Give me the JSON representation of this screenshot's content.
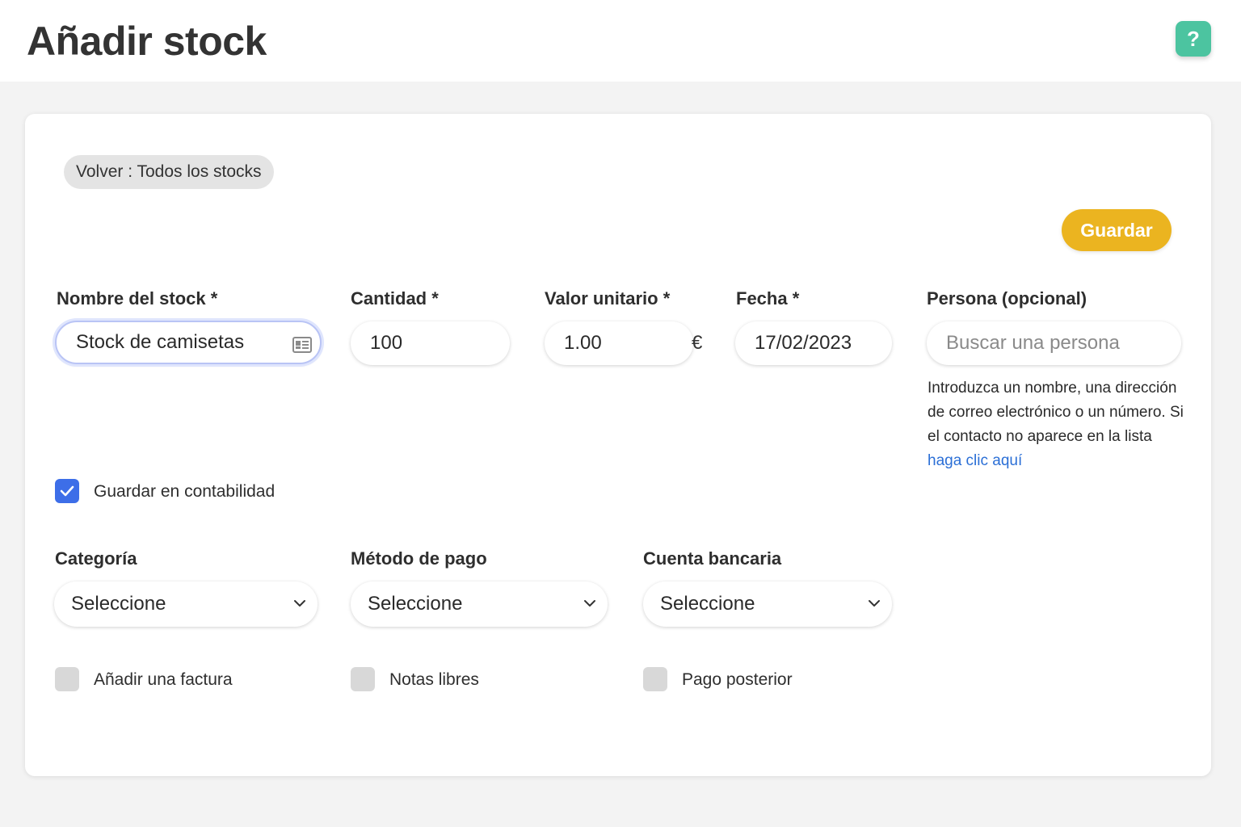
{
  "header": {
    "title": "Añadir stock",
    "help_label": "?"
  },
  "nav": {
    "back_label": "Volver : Todos los stocks"
  },
  "actions": {
    "save_label": "Guardar"
  },
  "form": {
    "name": {
      "label": "Nombre del stock *",
      "value": "Stock de camisetas",
      "icon": "contact-card-icon"
    },
    "quantity": {
      "label": "Cantidad *",
      "value": "100"
    },
    "unit_value": {
      "label": "Valor unitario *",
      "value": "1.00",
      "currency": "€"
    },
    "date": {
      "label": "Fecha *",
      "value": "17/02/2023"
    },
    "person": {
      "label": "Persona (opcional)",
      "placeholder": "Buscar una persona",
      "hint": "Introduzca un nombre, una dirección de correo electrónico o un número. Si el contacto no aparece en la lista",
      "hint_link": "haga clic aquí"
    },
    "accounting": {
      "label": "Guardar en contabilidad",
      "checked": true
    },
    "category": {
      "label": "Categoría",
      "value": "Seleccione"
    },
    "payment_method": {
      "label": "Método de pago",
      "value": "Seleccione"
    },
    "bank_account": {
      "label": "Cuenta bancaria",
      "value": "Seleccione"
    },
    "add_invoice": {
      "label": "Añadir una factura",
      "checked": false
    },
    "free_notes": {
      "label": "Notas libres",
      "checked": false
    },
    "later_payment": {
      "label": "Pago posterior",
      "checked": false
    }
  },
  "colors": {
    "accent": "#ebb420",
    "help": "#4cc4a0",
    "checkbox": "#3d6ee8",
    "link": "#2b6fd6"
  }
}
